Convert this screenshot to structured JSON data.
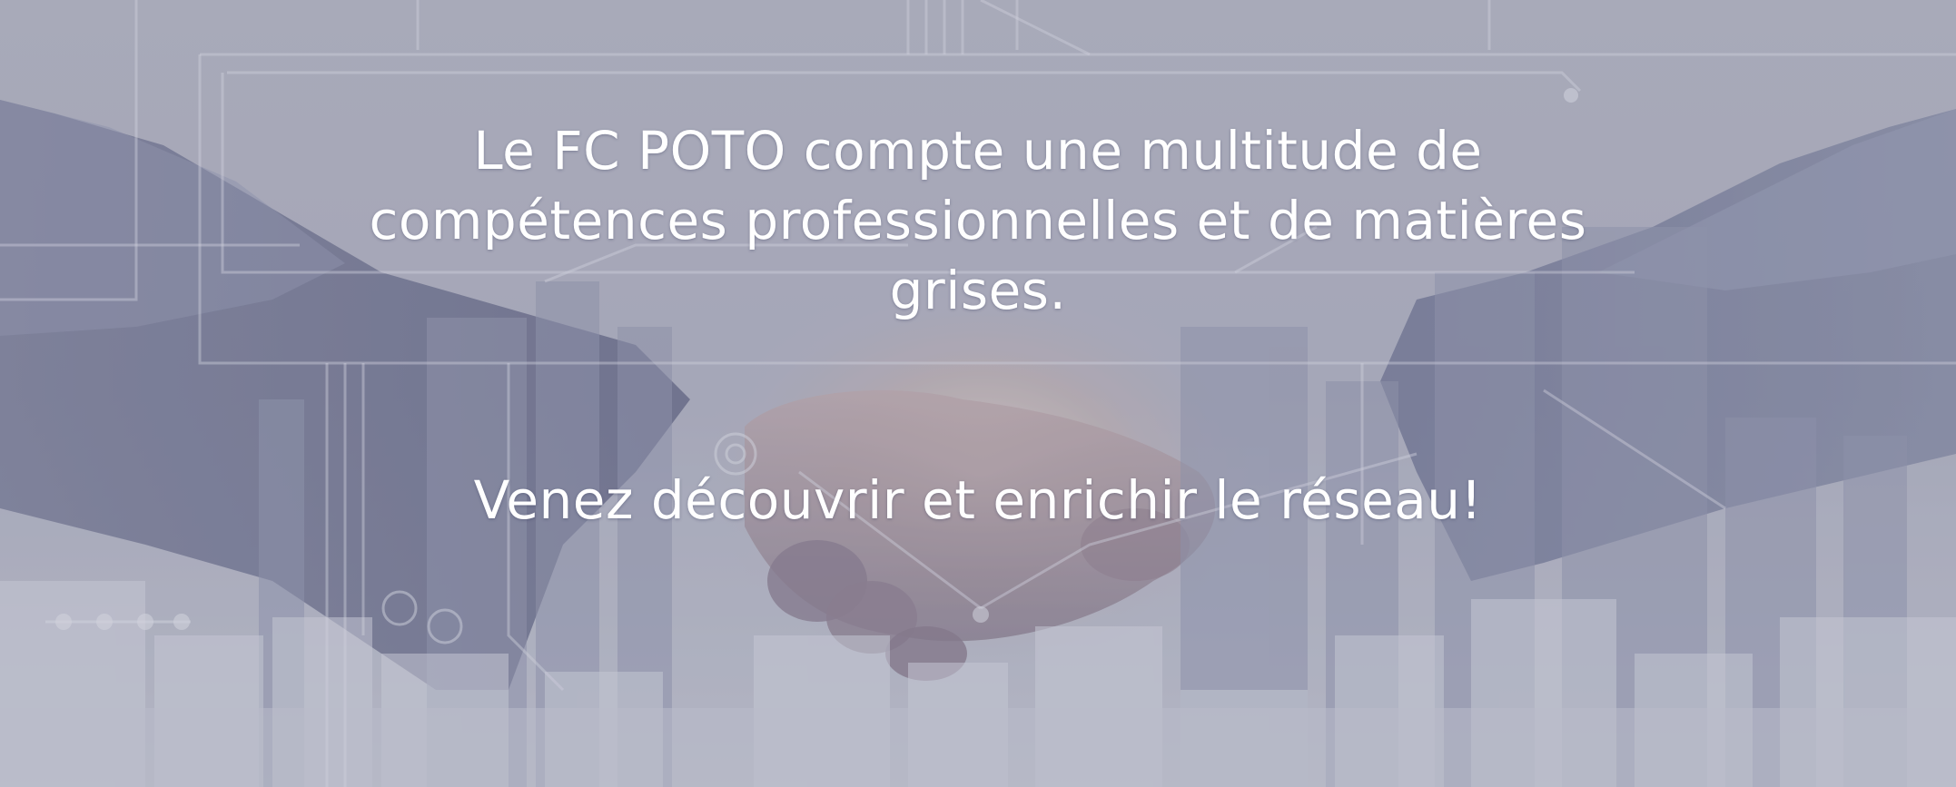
{
  "hero": {
    "headline_lines": [
      "Le FC POTO compte une multitude de",
      "compétences professionnelles et de matières",
      "grises."
    ],
    "subline": "Venez découvrir et enrichir le réseau!",
    "text_color": "#ffffff",
    "background_tint": "#a9aab8",
    "background_image": "handshake-city-skyline-image"
  }
}
